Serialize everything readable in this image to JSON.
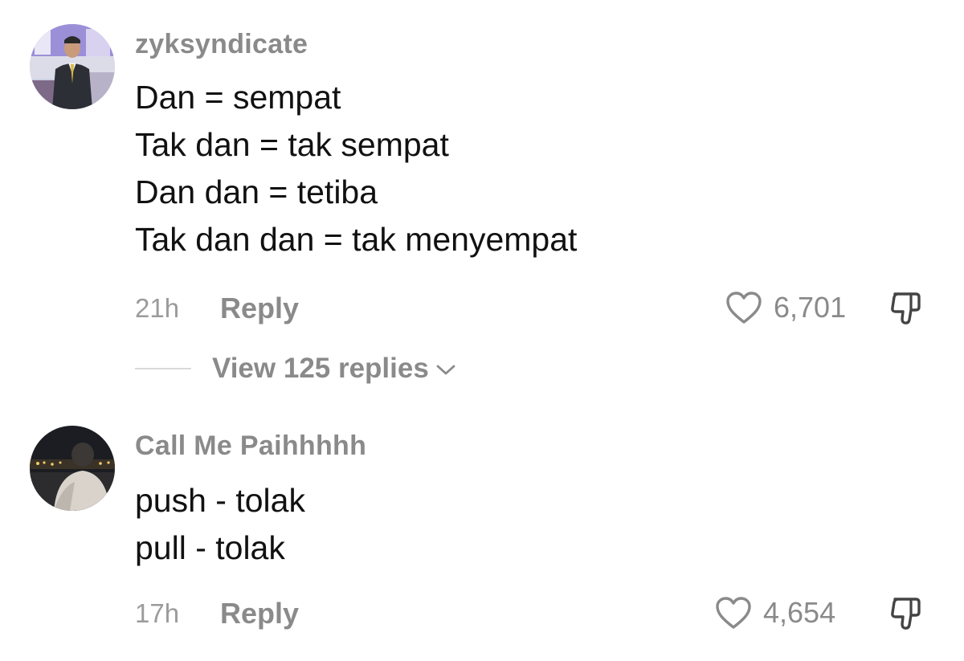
{
  "comments": [
    {
      "username": "zyksyndicate",
      "lines": [
        "Dan = sempat",
        "Tak dan = tak sempat",
        "Dan dan = tetiba",
        "Tak dan dan = tak menyempat"
      ],
      "time": "21h",
      "reply_label": "Reply",
      "likes": "6,701",
      "view_replies": "View 125 replies",
      "avatar": "man-in-suit-photo"
    },
    {
      "username": "Call Me Paihhhhh",
      "lines": [
        "push - tolak",
        "pull - tolak"
      ],
      "time": "17h",
      "reply_label": "Reply",
      "likes": "4,654",
      "avatar": "night-silhouette-photo"
    }
  ],
  "icons": {
    "like": "heart-outline-icon",
    "dislike": "thumbs-down-icon",
    "expand": "chevron-down-icon"
  },
  "colors": {
    "meta_text": "#8a8a8a",
    "body_text": "#111111",
    "background": "#ffffff"
  }
}
